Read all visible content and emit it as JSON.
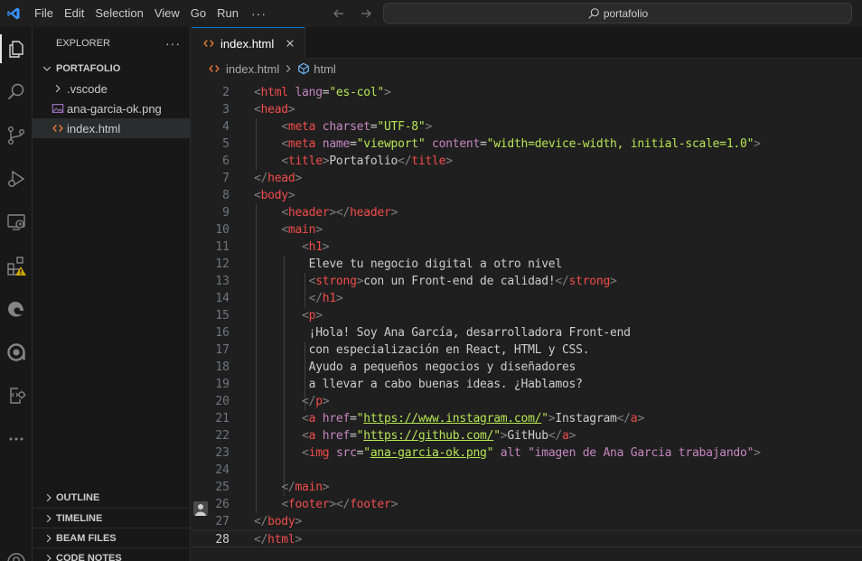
{
  "menu": {
    "file": "File",
    "edit": "Edit",
    "selection": "Selection",
    "view": "View",
    "go": "Go",
    "run": "Run",
    "more": "···"
  },
  "search": {
    "text": "portafolio"
  },
  "explorer": {
    "title": "EXPLORER",
    "actions": "···",
    "folder": "PORTAFOLIO",
    "items": [
      {
        "label": ".vscode",
        "icon": "chevron-right-icon"
      },
      {
        "label": "ana-garcia-ok.png",
        "icon": "image-file-icon"
      },
      {
        "label": "index.html",
        "icon": "html-file-icon"
      }
    ],
    "sections": [
      "OUTLINE",
      "TIMELINE",
      "BEAM FILES",
      "CODE NOTES"
    ]
  },
  "tab": {
    "label": "index.html"
  },
  "breadcrumb": {
    "file": "index.html",
    "symbol": "html"
  },
  "colors": {
    "accent": "#0078d4",
    "tag": "#f14c4c",
    "attribute": "#c586c0",
    "string": "#b5e655",
    "bracket": "#808080"
  },
  "code": {
    "line_numbers": [
      "2",
      "3",
      "4",
      "5",
      "6",
      "7",
      "8",
      "9",
      "10",
      "11",
      "12",
      "13",
      "14",
      "15",
      "16",
      "17",
      "18",
      "19",
      "20",
      "21",
      "22",
      "23",
      "24",
      "25",
      "26",
      "27",
      "28"
    ],
    "current_line": "28"
  }
}
